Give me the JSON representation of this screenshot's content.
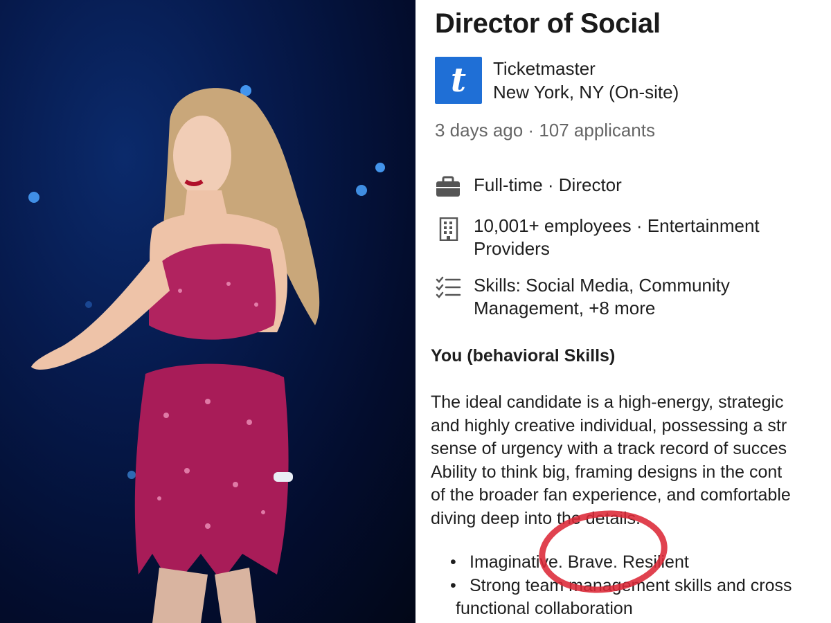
{
  "photo": {
    "description_icon": "performer-photo"
  },
  "job": {
    "title": "Director of Social",
    "company": "Ticketmaster",
    "logo_letter": "t",
    "location": "New York, NY (On-site)",
    "meta": "3 days ago · 107 applicants",
    "details": [
      {
        "icon": "briefcase-icon",
        "lines": [
          "Full-time · Director"
        ]
      },
      {
        "icon": "building-icon",
        "lines": [
          "10,001+ employees · Entertainment",
          "Providers"
        ]
      },
      {
        "icon": "checklist-icon",
        "lines": [
          "Skills: Social Media, Community",
          "Management, +8 more"
        ]
      }
    ],
    "section_heading": "You (behavioral Skills)",
    "paragraph_lines": [
      "The ideal candidate is a high-energy, strategic",
      "and highly creative individual, possessing a str",
      "sense of urgency with a track record of succes",
      "Ability to think big, framing designs in the cont",
      "of the broader fan experience, and comfortable",
      "diving deep into the details."
    ],
    "bullets": [
      {
        "line1": "Imaginative. Brave. Resilient"
      },
      {
        "line1": "Strong team management skills and cross",
        "line2": "functional collaboration"
      }
    ],
    "colors": {
      "logo_bg": "#1f6fd6",
      "annotation_circle": "#dc2837"
    }
  }
}
